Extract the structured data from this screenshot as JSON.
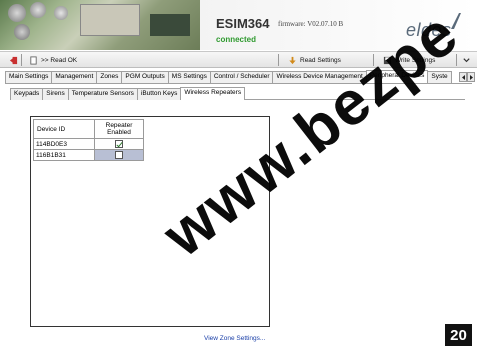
{
  "header": {
    "model": "ESIM364",
    "status": "connected",
    "firmware": "firmware: V02.07.10 B",
    "logo": "eldes"
  },
  "toolbar": {
    "read_ok_label": ">> Read OK",
    "read_settings_label": "Read Settings",
    "write_settings_label": "Write Settings"
  },
  "main_tabs": [
    "Main Settings",
    "Management",
    "Zones",
    "PGM Outputs",
    "MS Settings",
    "Control / Scheduler",
    "Wireless Device Management",
    "Peripheral Devices",
    "Syste"
  ],
  "sub_tabs": [
    "Keypads",
    "Sirens",
    "Temperature Sensors",
    "iButton Keys",
    "Wireless Repeaters"
  ],
  "grid": {
    "headers": {
      "device_id": "Device ID",
      "repeater_enabled": "Repeater Enabled"
    },
    "rows": [
      {
        "device_id": "114BD0E3",
        "repeater_enabled": true
      },
      {
        "device_id": "116B1B31",
        "repeater_enabled": false
      }
    ]
  },
  "zone_link": "View Zone Settings...",
  "page_number": "20",
  "watermark": "www.bezpe",
  "colors": {
    "status_green": "#2f9a2f",
    "selected_cell": "#b8bfd4",
    "link_blue": "#1a3fa8"
  }
}
